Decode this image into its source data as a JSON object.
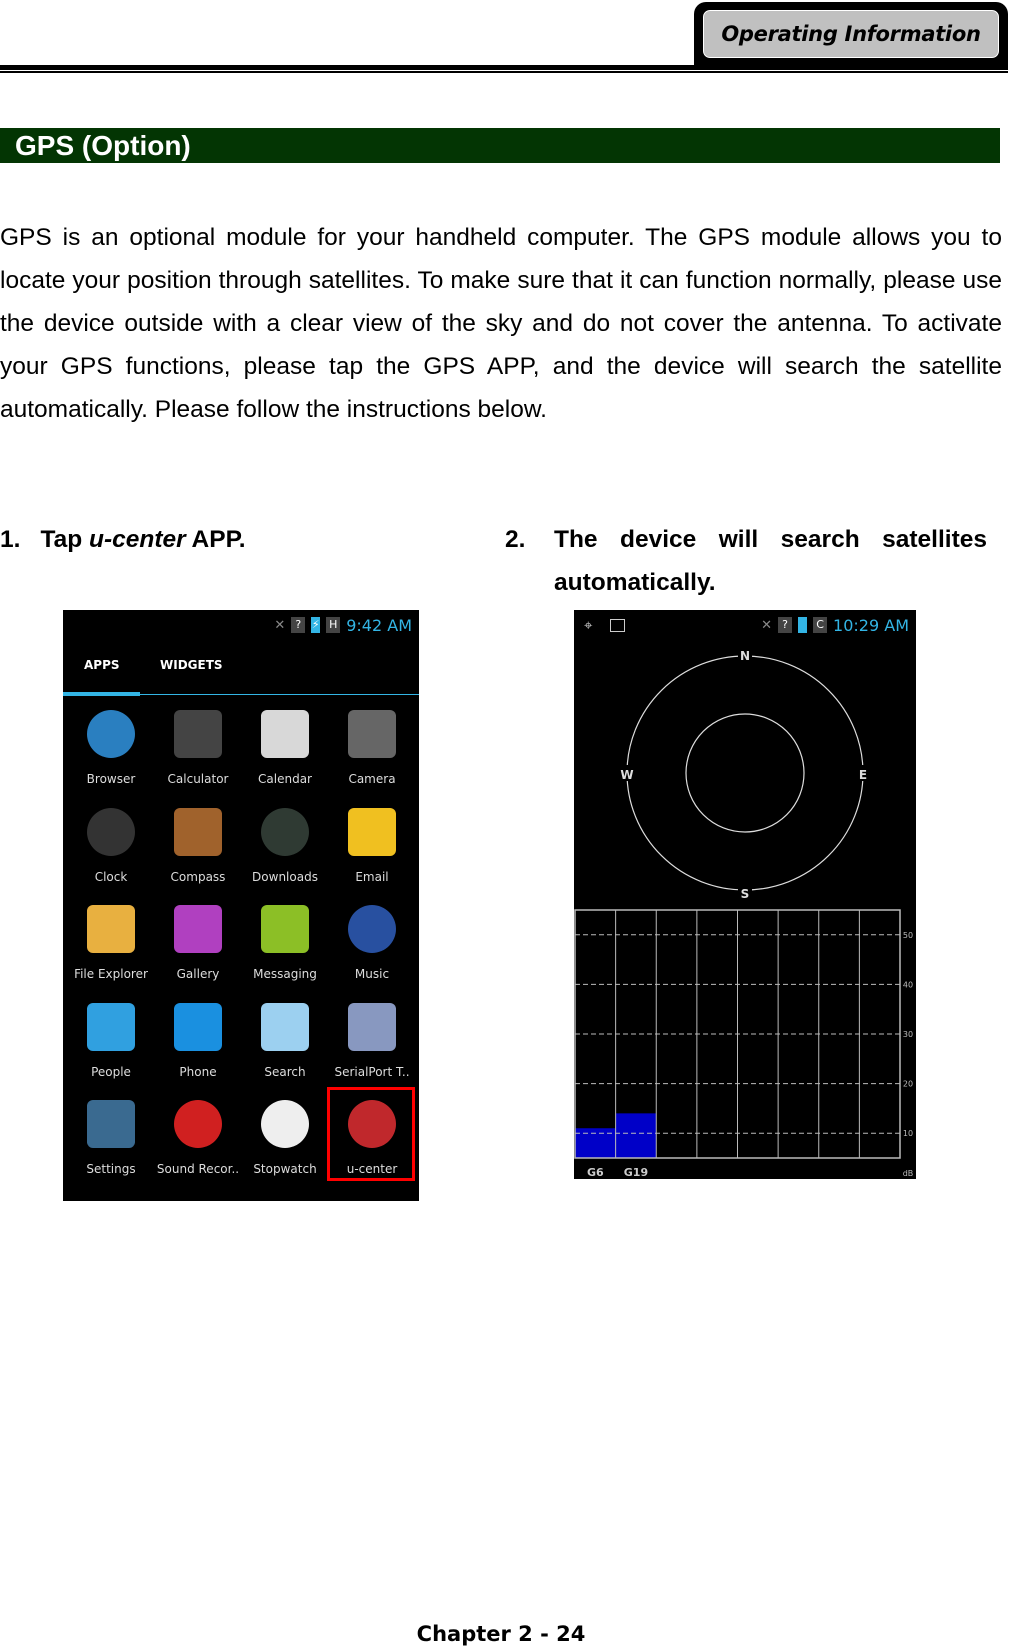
{
  "header": {
    "section_tab": "Operating Information"
  },
  "title": "GPS (Option)",
  "intro": "GPS is an optional module for your handheld computer. The GPS module allows you to locate your position through satellites. To make sure that it can function normally, please use the device outside with a clear view of the sky and do not cover the antenna. To activate your GPS functions, please tap the GPS APP, and the device will search the satellite automatically. Please follow the instructions below.",
  "steps": [
    {
      "num": "1.",
      "pre": "Tap ",
      "em": "u-center",
      "post": " APP."
    },
    {
      "num": "2.",
      "text": "The device will search satellites automatically."
    }
  ],
  "screen1": {
    "time": "9:42 AM",
    "network": "H",
    "tabs": [
      "APPS",
      "WIDGETS"
    ],
    "active_tab": "APPS",
    "accent": "#33b5e5",
    "apps": [
      {
        "label": "Browser",
        "icon": "globe-icon",
        "color": "#2a7fc0"
      },
      {
        "label": "Calculator",
        "icon": "calculator-icon",
        "color": "#444"
      },
      {
        "label": "Calendar",
        "icon": "calendar-icon",
        "color": "#d8d8d8"
      },
      {
        "label": "Camera",
        "icon": "camera-icon",
        "color": "#666"
      },
      {
        "label": "Clock",
        "icon": "clock-icon",
        "color": "#333"
      },
      {
        "label": "Compass",
        "icon": "compass-icon",
        "color": "#a0622c"
      },
      {
        "label": "Downloads",
        "icon": "download-icon",
        "color": "#2f3a33"
      },
      {
        "label": "Email",
        "icon": "email-icon",
        "color": "#f0c020"
      },
      {
        "label": "File Explorer",
        "icon": "folder-icon",
        "color": "#e8b040"
      },
      {
        "label": "Gallery",
        "icon": "gallery-icon",
        "color": "#b040c0"
      },
      {
        "label": "Messaging",
        "icon": "message-icon",
        "color": "#8cbf26"
      },
      {
        "label": "Music",
        "icon": "speaker-icon",
        "color": "#2850a0"
      },
      {
        "label": "People",
        "icon": "contacts-icon",
        "color": "#30a0e0"
      },
      {
        "label": "Phone",
        "icon": "phone-icon",
        "color": "#1a90e0"
      },
      {
        "label": "Search",
        "icon": "search-icon",
        "color": "#9cd0f0"
      },
      {
        "label": "SerialPort T..",
        "icon": "serial-port-icon",
        "color": "#8898c0"
      },
      {
        "label": "Settings",
        "icon": "settings-icon",
        "color": "#3a6a90"
      },
      {
        "label": "Sound Recor..",
        "icon": "microphone-icon",
        "color": "#d02020"
      },
      {
        "label": "Stopwatch",
        "icon": "stopwatch-icon",
        "color": "#eee"
      },
      {
        "label": "u-center",
        "icon": "u-center-icon",
        "color": "#c0282c"
      }
    ],
    "highlighted": "u-center",
    "highlight_color": "#ff0000"
  },
  "screen2": {
    "time": "10:29 AM",
    "network": "C",
    "compass": {
      "n": "N",
      "s": "S",
      "e": "E",
      "w": "W"
    },
    "chart_data": {
      "type": "bar",
      "categories": [
        "G6",
        "G19"
      ],
      "values": [
        11,
        14
      ],
      "ylabel": "dB",
      "yticks": [
        10,
        20,
        30,
        40,
        50
      ],
      "ylim": [
        5,
        55
      ],
      "slots": 8,
      "bar_color": "#0000c8",
      "grid": true
    }
  },
  "footer": "Chapter 2 - 24"
}
